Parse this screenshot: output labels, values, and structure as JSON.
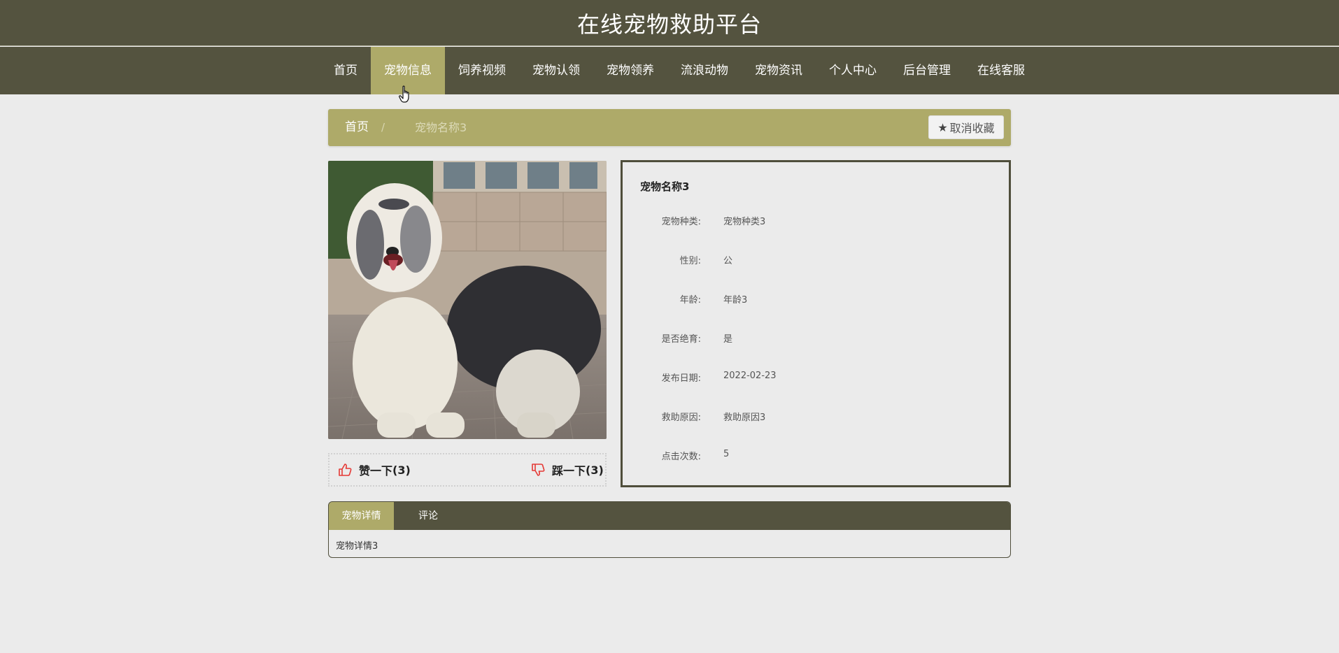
{
  "site": {
    "title": "在线宠物救助平台"
  },
  "nav": {
    "items": [
      "首页",
      "宠物信息",
      "饲养视频",
      "宠物认领",
      "宠物领养",
      "流浪动物",
      "宠物资讯",
      "个人中心",
      "后台管理",
      "在线客服"
    ],
    "active_index": 1
  },
  "breadcrumb": {
    "home": "首页",
    "separator": "/",
    "current": "宠物名称3"
  },
  "favorite": {
    "label": "取消收藏",
    "icon": "star-icon"
  },
  "votes": {
    "like": {
      "label": "赞一下",
      "count": "(3)",
      "icon": "thumbs-up-icon"
    },
    "dislike": {
      "label": "踩一下",
      "count": "(3)",
      "icon": "thumbs-down-icon"
    }
  },
  "pet": {
    "name": "宠物名称3",
    "fields": [
      {
        "label": "宠物种类:",
        "value": "宠物种类3"
      },
      {
        "label": "性别:",
        "value": "公"
      },
      {
        "label": "年龄:",
        "value": "年龄3"
      },
      {
        "label": "是否绝育:",
        "value": "是"
      },
      {
        "label": "发布日期:",
        "value": "2022-02-23"
      },
      {
        "label": "救助原因:",
        "value": "救助原因3"
      },
      {
        "label": "点击次数:",
        "value": "5"
      }
    ]
  },
  "tabs": {
    "items": [
      "宠物详情",
      "评论"
    ],
    "active_index": 0,
    "content": "宠物详情3"
  },
  "colors": {
    "header_bg": "#54533f",
    "accent": "#aeaa69",
    "page_bg": "#ebebeb",
    "vote_icon": "#e53935"
  }
}
